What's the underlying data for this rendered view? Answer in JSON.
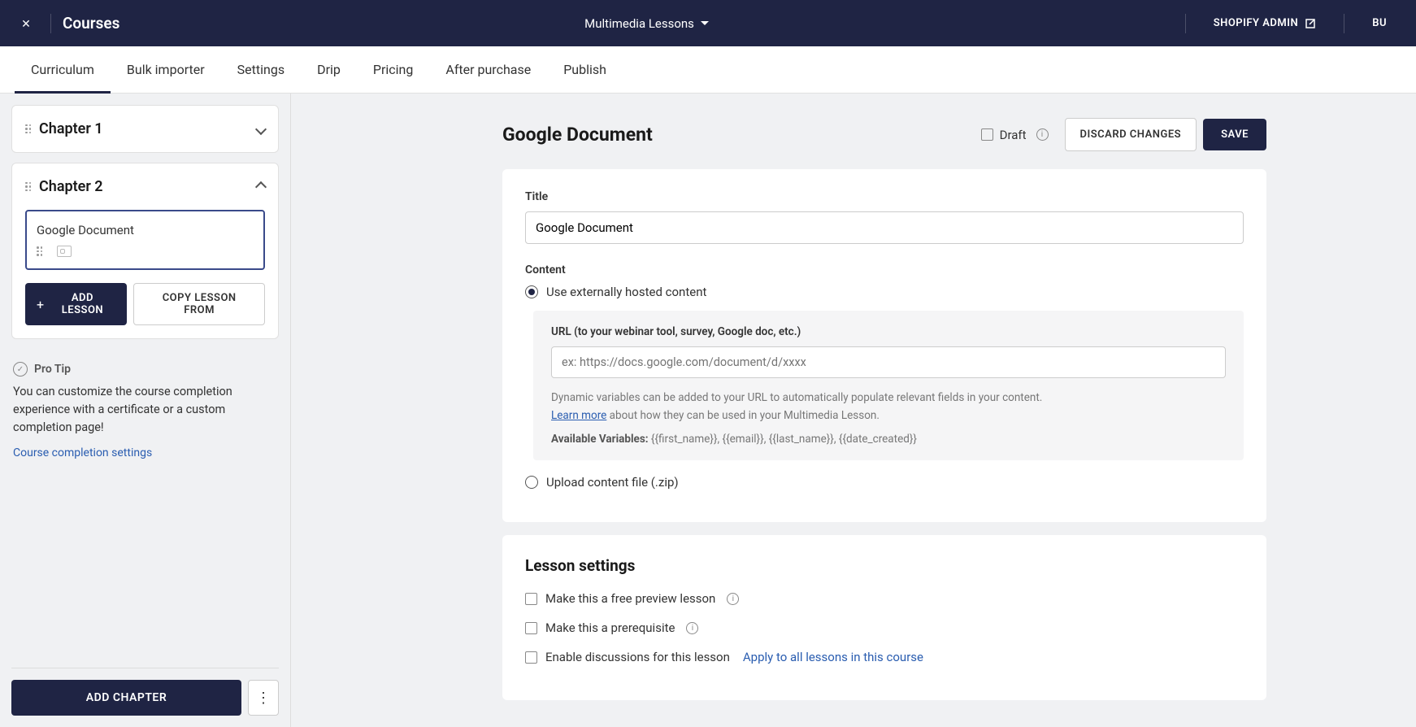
{
  "topbar": {
    "title": "Courses",
    "center_label": "Multimedia Lessons",
    "shopify_admin": "SHOPIFY ADMIN",
    "right_trunc": "BU"
  },
  "tabs": [
    "Curriculum",
    "Bulk importer",
    "Settings",
    "Drip",
    "Pricing",
    "After purchase",
    "Publish"
  ],
  "active_tab": 0,
  "sidebar": {
    "chapters": [
      {
        "title": "Chapter 1",
        "expanded": false
      },
      {
        "title": "Chapter 2",
        "expanded": true,
        "lessons": [
          {
            "title": "Google Document"
          }
        ]
      }
    ],
    "add_lesson": "ADD LESSON",
    "copy_lesson": "COPY LESSON FROM",
    "protip_label": "Pro Tip",
    "protip_text": "You can customize the course completion experience with a certificate or a custom completion page!",
    "protip_link": "Course completion settings",
    "add_chapter": "ADD CHAPTER"
  },
  "main": {
    "page_title": "Google Document",
    "draft_label": "Draft",
    "discard": "DISCARD CHANGES",
    "save": "SAVE",
    "title_label": "Title",
    "title_value": "Google Document",
    "content_label": "Content",
    "radio_external": "Use externally hosted content",
    "radio_upload": "Upload content file (.zip)",
    "url_label": "URL (to your webinar tool, survey, Google doc, etc.)",
    "url_placeholder": "ex: https://docs.google.com/document/d/xxxx",
    "url_help_1": "Dynamic variables can be added to your URL to automatically populate relevant fields in your content.",
    "url_help_link": "Learn more",
    "url_help_2": " about how they can be used in your Multimedia Lesson.",
    "vars_label": "Available Variables:",
    "vars_value": " {{first_name}}, {{email}}, {{last_name}}, {{date_created}}",
    "settings_title": "Lesson settings",
    "setting_preview": "Make this a free preview lesson",
    "setting_prereq": "Make this a prerequisite",
    "setting_discuss": "Enable discussions for this lesson",
    "apply_all": "Apply to all lessons in this course"
  }
}
